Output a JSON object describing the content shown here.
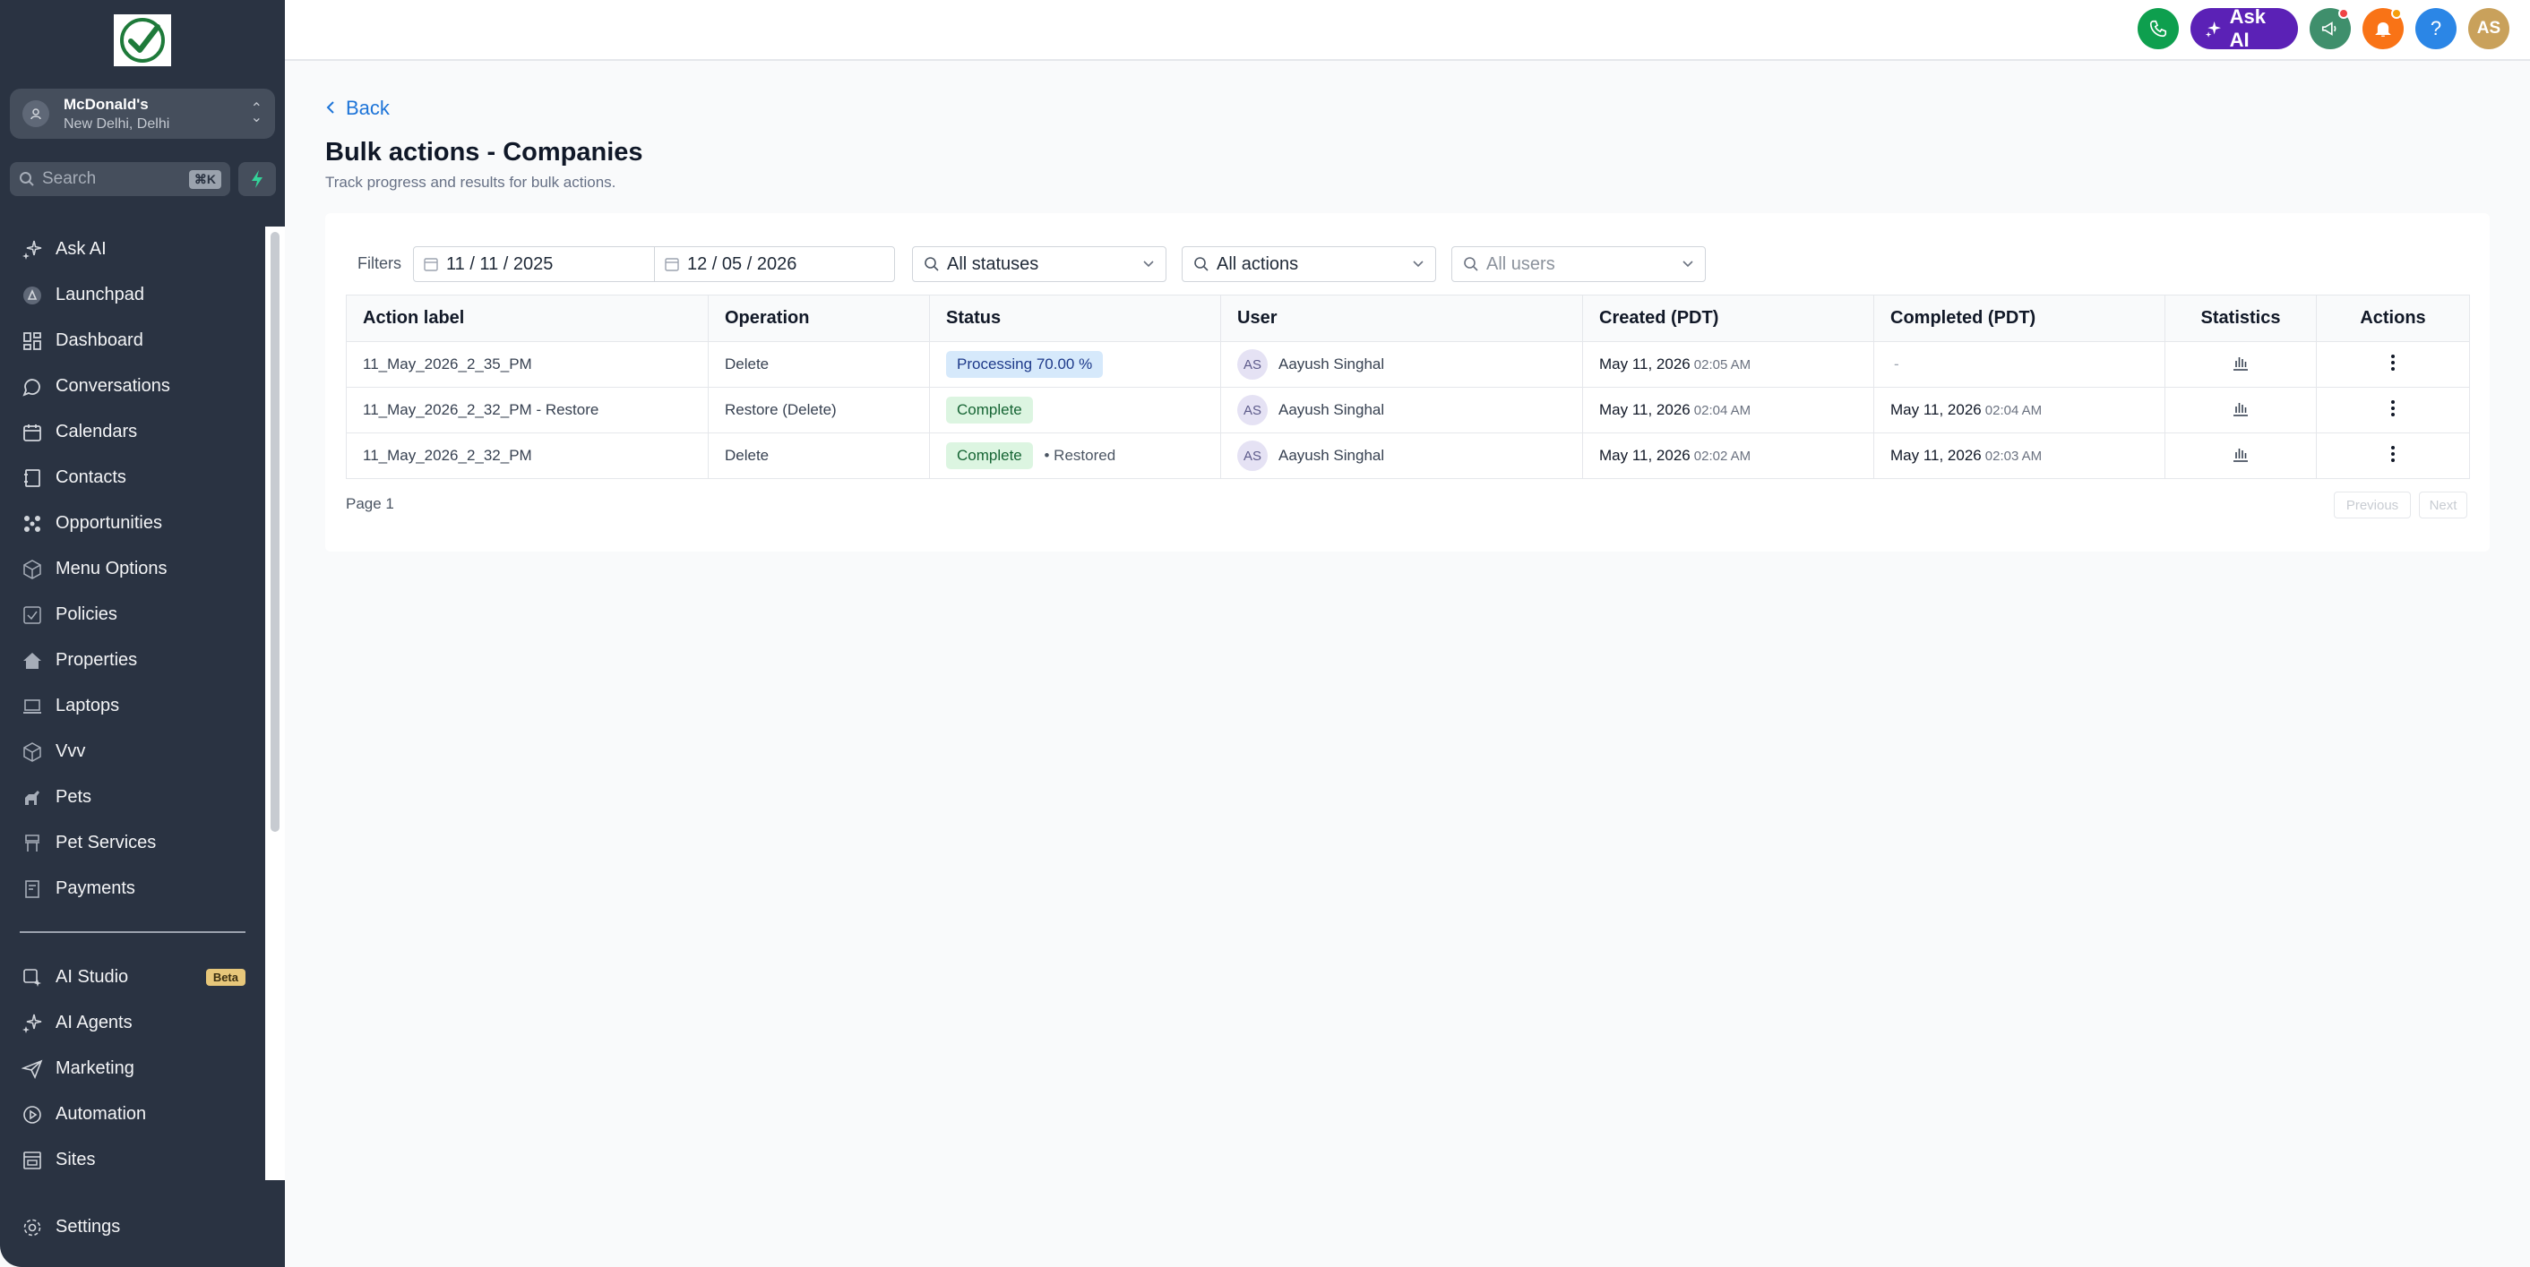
{
  "sidebar": {
    "location": {
      "name": "McDonald's",
      "sub": "New Delhi, Delhi"
    },
    "search": {
      "placeholder": "Search",
      "shortcut": "⌘K"
    },
    "items": [
      {
        "label": "Ask AI",
        "icon": "sparkle-icon"
      },
      {
        "label": "Launchpad",
        "icon": "launchpad-icon"
      },
      {
        "label": "Dashboard",
        "icon": "dashboard-icon"
      },
      {
        "label": "Conversations",
        "icon": "chat-icon"
      },
      {
        "label": "Calendars",
        "icon": "calendar-icon"
      },
      {
        "label": "Contacts",
        "icon": "contacts-icon"
      },
      {
        "label": "Opportunities",
        "icon": "opportunities-icon"
      },
      {
        "label": "Menu Options",
        "icon": "cube-icon"
      },
      {
        "label": "Policies",
        "icon": "checkbox-icon"
      },
      {
        "label": "Properties",
        "icon": "home-icon"
      },
      {
        "label": "Laptops",
        "icon": "laptop-icon"
      },
      {
        "label": "Vvv",
        "icon": "cube-icon"
      },
      {
        "label": "Pets",
        "icon": "pet-icon"
      },
      {
        "label": "Pet Services",
        "icon": "chair-icon"
      },
      {
        "label": "Payments",
        "icon": "receipt-icon"
      }
    ],
    "items2": [
      {
        "label": "AI Studio",
        "icon": "ai-studio-icon",
        "badge": "Beta"
      },
      {
        "label": "AI Agents",
        "icon": "sparkle-icon"
      },
      {
        "label": "Marketing",
        "icon": "send-icon"
      },
      {
        "label": "Automation",
        "icon": "automation-icon"
      },
      {
        "label": "Sites",
        "icon": "sites-icon"
      }
    ],
    "settings": {
      "label": "Settings",
      "icon": "gear-icon"
    }
  },
  "topbar": {
    "ask_ai": "Ask AI",
    "help": "?",
    "avatar": "AS"
  },
  "page": {
    "back": "Back",
    "title": "Bulk actions - Companies",
    "subtitle": "Track progress and results for bulk actions."
  },
  "filters": {
    "label": "Filters",
    "date_from": "11 / 11 / 2025",
    "date_to": "12 / 05 / 2026",
    "status": "All statuses",
    "actions": "All actions",
    "users": "All users"
  },
  "table": {
    "headers": [
      "Action label",
      "Operation",
      "Status",
      "User",
      "Created (PDT)",
      "Completed (PDT)",
      "Statistics",
      "Actions"
    ],
    "rows": [
      {
        "label": "11_May_2026_2_35_PM",
        "operation": "Delete",
        "status": "Processing 70.00 %",
        "status_extra": "",
        "user_initials": "AS",
        "user": "Aayush Singhal",
        "created_date": "May 11, 2026",
        "created_time": "02:05 AM",
        "completed_date": "",
        "completed_time": "",
        "completed_empty": "-"
      },
      {
        "label": "11_May_2026_2_32_PM - Restore",
        "operation": "Restore (Delete)",
        "status": "Complete",
        "status_extra": "",
        "user_initials": "AS",
        "user": "Aayush Singhal",
        "created_date": "May 11, 2026",
        "created_time": "02:04 AM",
        "completed_date": "May 11, 2026",
        "completed_time": "02:04 AM",
        "completed_empty": ""
      },
      {
        "label": "11_May_2026_2_32_PM",
        "operation": "Delete",
        "status": "Complete",
        "status_extra": "• Restored",
        "user_initials": "AS",
        "user": "Aayush Singhal",
        "created_date": "May 11, 2026",
        "created_time": "02:02 AM",
        "completed_date": "May 11, 2026",
        "completed_time": "02:03 AM",
        "completed_empty": ""
      }
    ]
  },
  "pagination": {
    "page_label": "Page 1",
    "previous": "Previous",
    "next": "Next"
  },
  "colors": {
    "sidebar_bg": "#2a3342",
    "accent_blue": "#1d74d8",
    "ask_ai_purple": "#5b21b6",
    "phone_green": "#0e9f4e",
    "processing_bg": "#d6e9fb",
    "complete_bg": "#dcf5e1"
  }
}
